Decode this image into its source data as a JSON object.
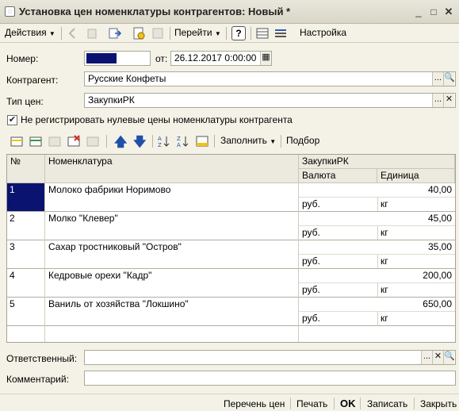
{
  "window": {
    "title": "Установка цен номенклатуры контрагентов: Новый *",
    "minimize": "_",
    "maximize": "□",
    "close": "✕"
  },
  "toolbar": {
    "actions_label": "Действия",
    "goto_label": "Перейти",
    "help_label": "?",
    "settings_label": "Настройка"
  },
  "form": {
    "number_label": "Номер:",
    "date_label": "от:",
    "date_value": "26.12.2017  0:00:00",
    "counterparty_label": "Контрагент:",
    "counterparty_value": "Русские Конфеты",
    "price_type_label": "Тип цен:",
    "price_type_value": "ЗакупкиРК",
    "skip_zero_label": "Не регистрировать нулевые цены номенклатуры контрагента",
    "skip_zero_checked": true
  },
  "table_toolbar": {
    "fill_label": "Заполнить",
    "pick_label": "Подбор"
  },
  "table": {
    "headers": {
      "num": "№",
      "nomenclature": "Номенклатура",
      "price_group": "ЗакупкиРК",
      "currency": "Валюта",
      "unit": "Единица"
    },
    "rows": [
      {
        "num": "1",
        "name": "Молоко фабрики Норимово",
        "price": "40,00",
        "currency": "руб.",
        "unit": "кг"
      },
      {
        "num": "2",
        "name": "Молко \"Клевер\"",
        "price": "45,00",
        "currency": "руб.",
        "unit": "кг"
      },
      {
        "num": "3",
        "name": "Сахар тростниковый \"Остров\"",
        "price": "35,00",
        "currency": "руб.",
        "unit": "кг"
      },
      {
        "num": "4",
        "name": "Кедровые орехи \"Кадр\"",
        "price": "200,00",
        "currency": "руб.",
        "unit": "кг"
      },
      {
        "num": "5",
        "name": "Ваниль от хозяйства \"Локшино\"",
        "price": "650,00",
        "currency": "руб.",
        "unit": "кг"
      }
    ]
  },
  "footer_form": {
    "responsible_label": "Ответственный:",
    "responsible_value": "",
    "comment_label": "Комментарий:",
    "comment_value": ""
  },
  "bottom": {
    "price_list": "Перечень цен",
    "print": "Печать",
    "ok": "OK",
    "save": "Записать",
    "close": "Закрыть"
  },
  "colors": {
    "selection": "#0a1470",
    "background": "#f4f2e6",
    "header": "#ece9df"
  }
}
